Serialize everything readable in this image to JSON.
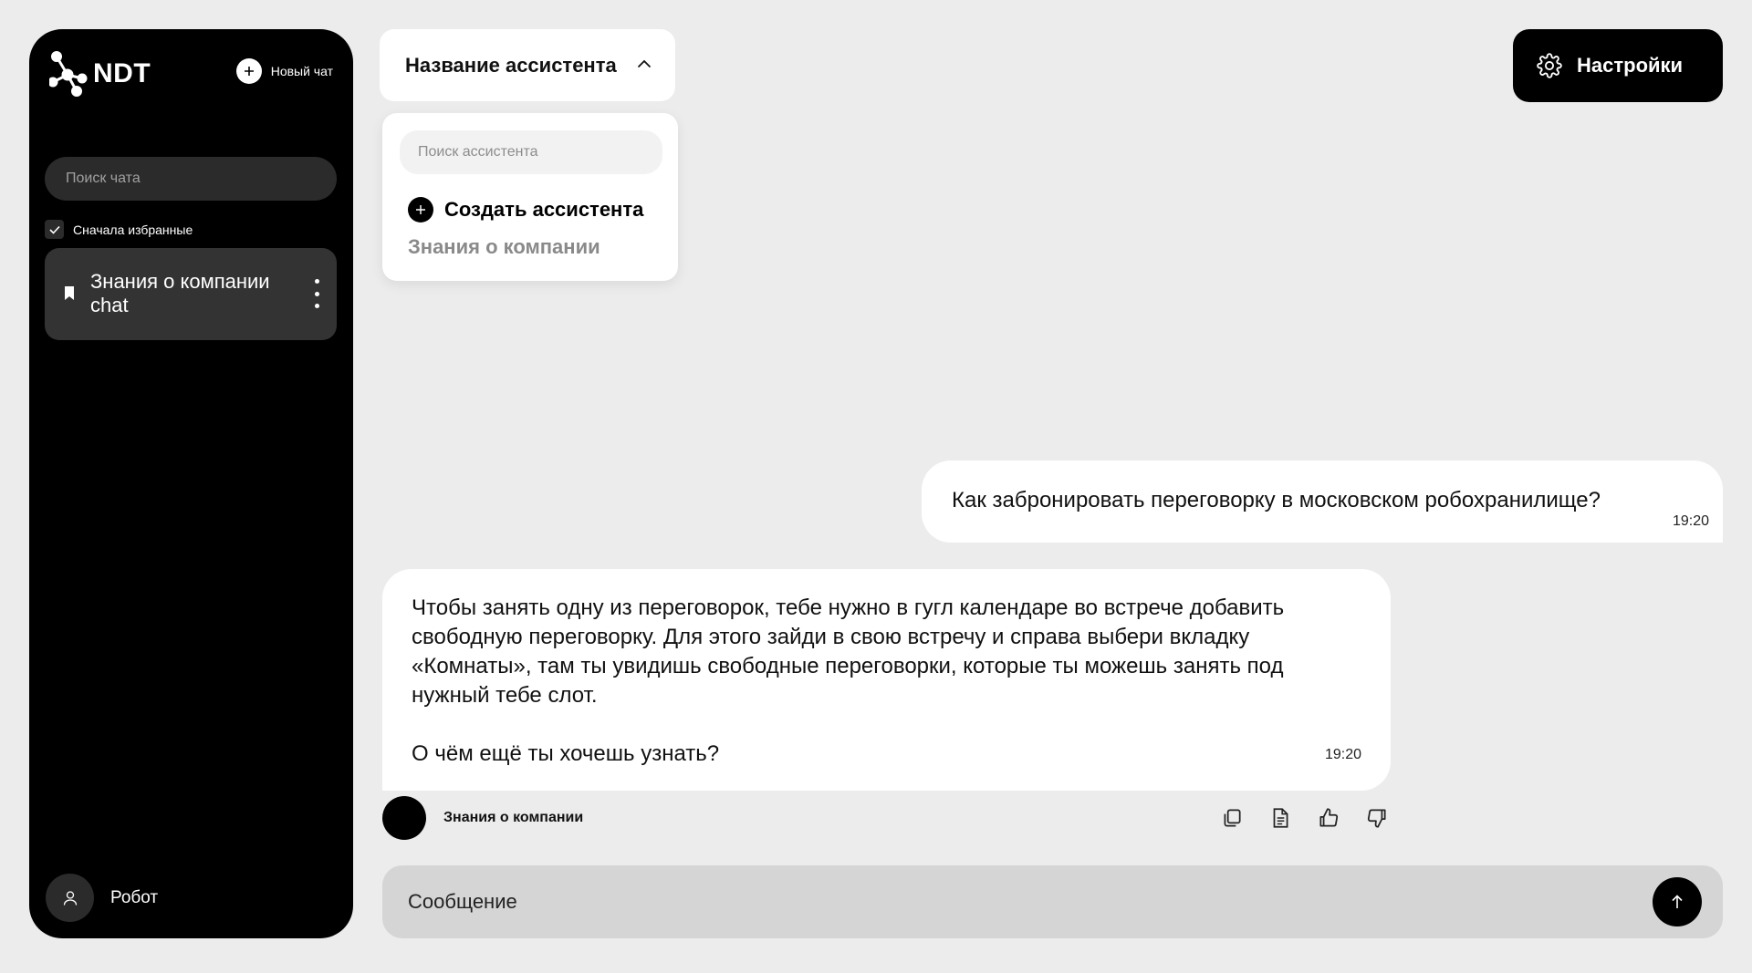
{
  "sidebar": {
    "logo_text": "NDT",
    "new_chat_label": "Новый чат",
    "search_placeholder": "Поиск чата",
    "favorites_first_label": "Сначала избранные",
    "favorites_first_checked": true,
    "chats": [
      {
        "title": "Знания о компании chat",
        "bookmarked": true
      }
    ],
    "user": {
      "name": "Робот"
    }
  },
  "header": {
    "assistant_select_label": "Название ассистента",
    "settings_label": "Настройки"
  },
  "assistant_dropdown": {
    "search_placeholder": "Поиск ассистента",
    "create_label": "Создать ассистента",
    "items": [
      "Знания о компании"
    ]
  },
  "messages": [
    {
      "role": "user",
      "text": "Как забронировать переговорку в московском робохранилище?",
      "time": "19:20"
    },
    {
      "role": "assistant",
      "text": "Чтобы занять одну из переговорок, тебе нужно в гугл календаре во встрече добавить свободную переговорку. Для этого зайди в свою встречу и справа выбери вкладку «Комнаты», там ты увидишь свободные переговорки, которые ты можешь занять под нужный тебе слот.\n\nО чём ещё ты хочешь узнать?",
      "time": "19:20",
      "assistant_name": "Знания о компании"
    }
  ],
  "message_actions": [
    "copy-icon",
    "document-icon",
    "thumbs-up-icon",
    "thumbs-down-icon"
  ],
  "composer": {
    "placeholder": "Сообщение"
  },
  "colors": {
    "background": "#ececec",
    "sidebar": "#000000",
    "accent": "#000000",
    "bubble": "#ffffff",
    "composer": "#d5d5d5"
  }
}
